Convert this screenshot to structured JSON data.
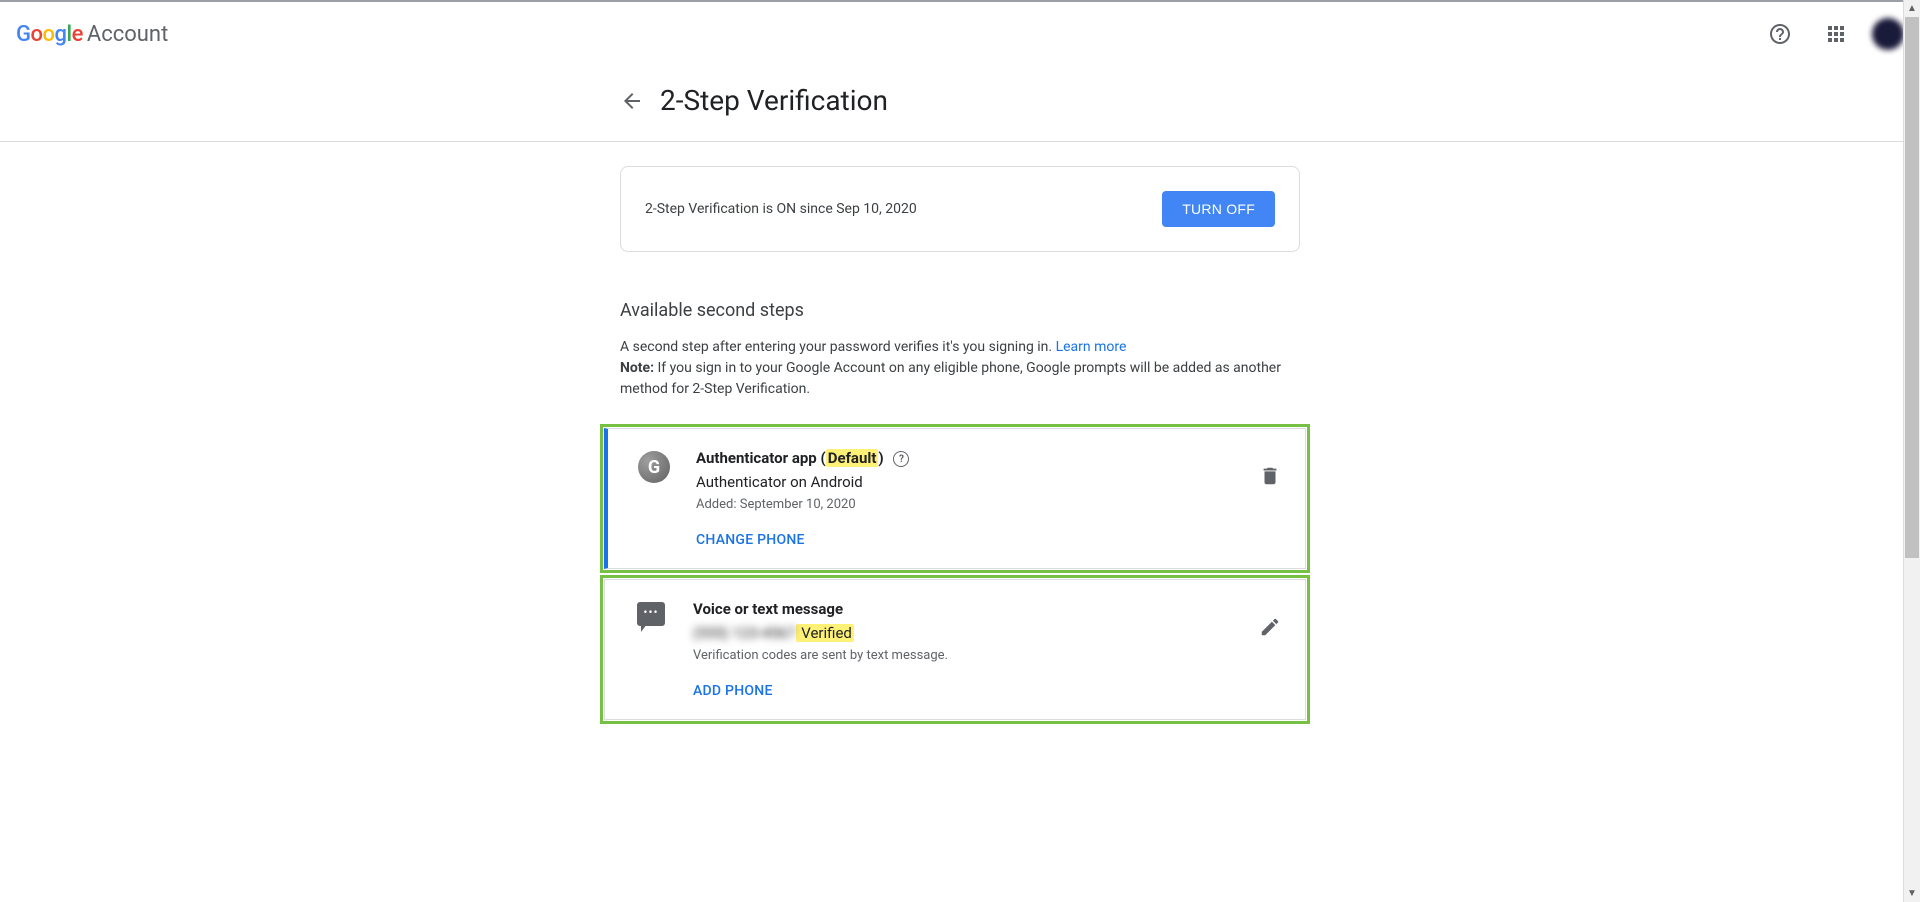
{
  "header": {
    "logo_g": "G",
    "logo_o1": "o",
    "logo_o2": "o",
    "logo_g2": "g",
    "logo_l": "l",
    "logo_e": "e",
    "account_label": "Account"
  },
  "page_title": "2-Step Verification",
  "status": {
    "text": "2-Step Verification is ON since Sep 10, 2020",
    "button": "TURN OFF"
  },
  "section": {
    "heading": "Available second steps",
    "desc_part1": "A second step after entering your password verifies it's you signing in. ",
    "learn_more": "Learn more",
    "note_label": "Note:",
    "desc_part2": " If you sign in to your Google Account on any eligible phone, Google prompts will be added as another method for 2-Step Verification."
  },
  "methods": {
    "authenticator": {
      "title_prefix": "Authenticator app (",
      "title_default": "Default",
      "title_suffix": ")",
      "subtitle": "Authenticator on Android",
      "added": "Added: September 10, 2020",
      "action": "CHANGE PHONE"
    },
    "voice": {
      "title": "Voice or text message",
      "phone_masked": "(555) 123-4567",
      "verified": " Verified",
      "desc": "Verification codes are sent by text message.",
      "action": "ADD PHONE"
    }
  }
}
